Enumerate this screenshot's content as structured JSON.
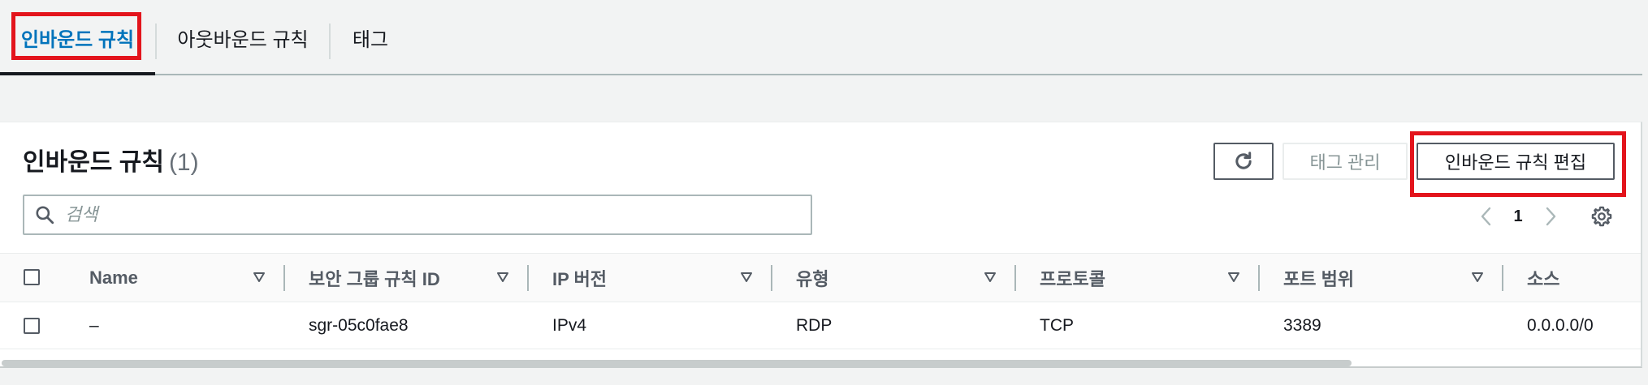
{
  "tabs": [
    {
      "label": "인바운드 규칙",
      "active": true
    },
    {
      "label": "아웃바운드 규칙",
      "active": false
    },
    {
      "label": "태그",
      "active": false
    }
  ],
  "panel": {
    "title": "인바운드 규칙",
    "count": "(1)",
    "buttons": {
      "refresh_icon": "refresh-icon",
      "manage_tags": "태그 관리",
      "edit_rules": "인바운드 규칙 편집"
    },
    "search": {
      "placeholder": "검색",
      "value": ""
    },
    "pagination": {
      "current_page": "1"
    }
  },
  "table": {
    "columns": [
      "Name",
      "보안 그룹 규칙 ID",
      "IP 버전",
      "유형",
      "프로토콜",
      "포트 범위",
      "소스"
    ],
    "rows": [
      [
        "–",
        "sgr-05c0fae8",
        "IPv4",
        "RDP",
        "TCP",
        "3389",
        "0.0.0.0/0"
      ]
    ]
  },
  "colors": {
    "accent": "#0073bb",
    "highlight": "#e3141c",
    "text": "#16191f",
    "muted": "#545b64",
    "disabled": "#879596"
  }
}
